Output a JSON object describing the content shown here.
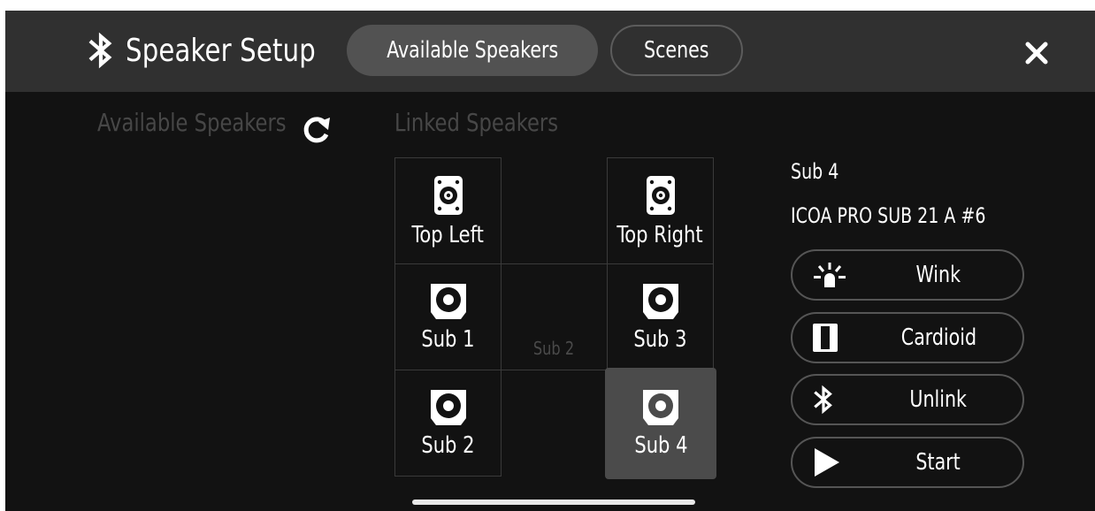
{
  "header": {
    "title": "Speaker Setup",
    "tabs": [
      {
        "label": "Available Speakers",
        "active": true
      },
      {
        "label": "Scenes",
        "active": false
      }
    ]
  },
  "available": {
    "heading": "Available Speakers"
  },
  "linked": {
    "heading": "Linked Speakers",
    "cells": [
      {
        "label": "Top Left",
        "icon": "speaker-top-icon"
      },
      {
        "label": "Top Right",
        "icon": "speaker-top-icon"
      },
      {
        "label": "Sub 1",
        "icon": "subwoofer-icon"
      },
      {
        "label": "Sub 3",
        "icon": "subwoofer-icon"
      },
      {
        "label": "Sub 2",
        "icon": "subwoofer-icon"
      },
      {
        "label": "Sub 4",
        "icon": "subwoofer-icon",
        "selected": true
      }
    ],
    "ghost_label": "Sub 2"
  },
  "detail": {
    "name": "Sub 4",
    "model": "ICOA PRO SUB 21 A #6",
    "actions": [
      {
        "label": "Wink",
        "icon": "wink-light-icon"
      },
      {
        "label": "Cardioid",
        "icon": "cardioid-icon"
      },
      {
        "label": "Unlink",
        "icon": "bluetooth-icon"
      },
      {
        "label": "Start",
        "icon": "play-icon"
      }
    ]
  },
  "colors": {
    "background": "#121212",
    "header": "#303030",
    "active_tab": "#525252",
    "selected_cell": "#4b4b4b",
    "muted_text": "#474747"
  }
}
